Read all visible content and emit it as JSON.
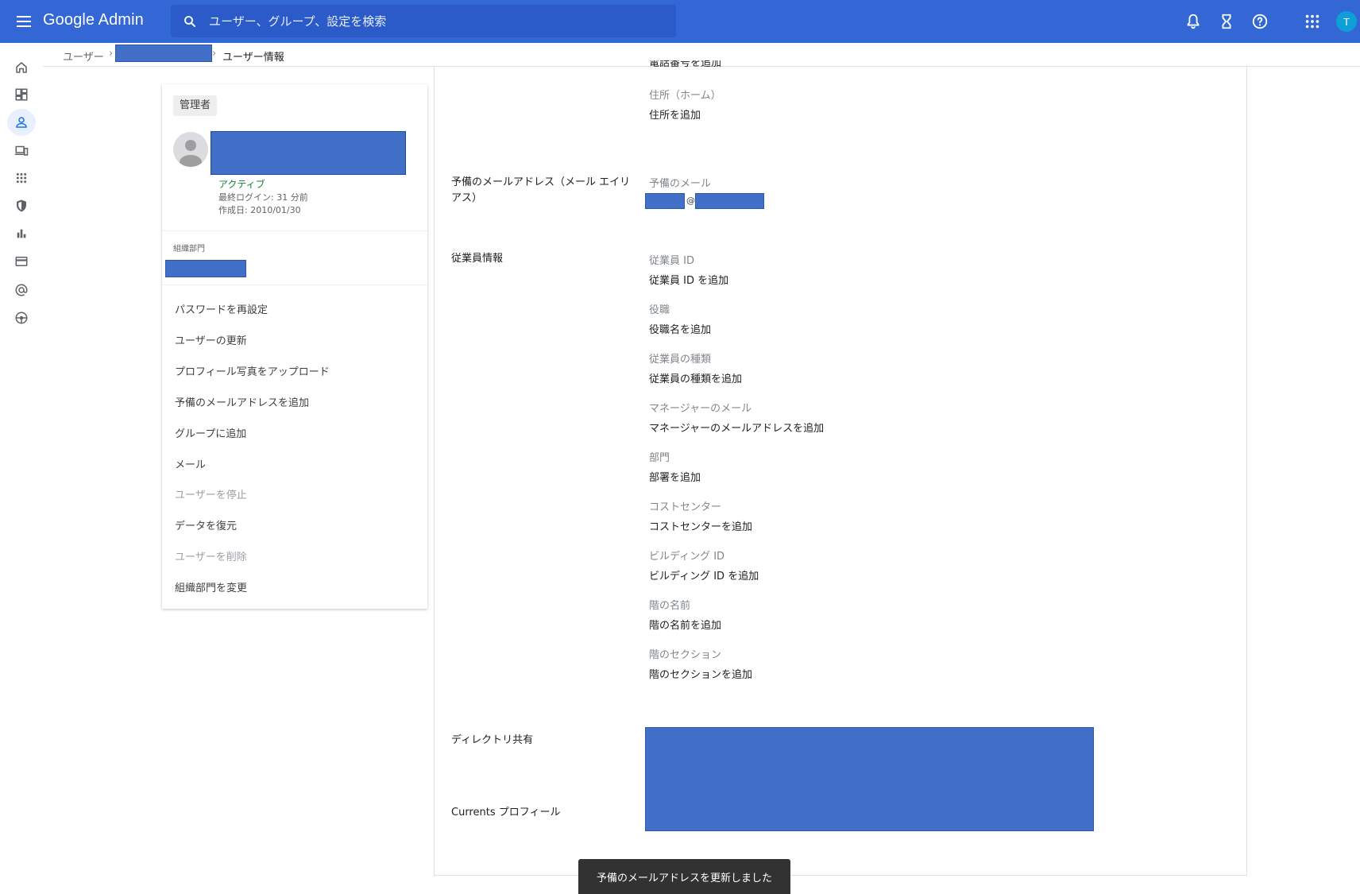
{
  "header": {
    "logo_text": "Google Admin",
    "search_placeholder": "ユーザー、グループ、設定を検索",
    "avatar_initial": "T"
  },
  "breadcrumb": {
    "users": "ユーザー",
    "separator": "›",
    "current": "ユーザー情報"
  },
  "user_card": {
    "role": "管理者",
    "status": "アクティブ",
    "last_login": "最終ログイン: 31 分前",
    "created": "作成日: 2010/01/30",
    "org_unit_label": "組織部門",
    "actions": [
      {
        "label": "パスワードを再設定",
        "enabled": true
      },
      {
        "label": "ユーザーの更新",
        "enabled": true
      },
      {
        "label": "プロフィール写真をアップロード",
        "enabled": true
      },
      {
        "label": "予備のメールアドレスを追加",
        "enabled": true
      },
      {
        "label": "グループに追加",
        "enabled": true
      },
      {
        "label": "メール",
        "enabled": true
      },
      {
        "label": "ユーザーを停止",
        "enabled": false
      },
      {
        "label": "データを復元",
        "enabled": true
      },
      {
        "label": "ユーザーを削除",
        "enabled": false
      },
      {
        "label": "組織部門を変更",
        "enabled": true
      }
    ]
  },
  "details": {
    "clipped_top_text": "電話番号を追加",
    "address_home_label": "住所（ホーム）",
    "address_home_value": "住所を追加",
    "alt_email_section": "予備のメールアドレス（メール エイリアス）",
    "alt_email_label": "予備のメール",
    "at_sign": "@",
    "employee_section": "従業員情報",
    "employee_fields": [
      {
        "label": "従業員 ID",
        "value": "従業員 ID を追加"
      },
      {
        "label": "役職",
        "value": "役職名を追加"
      },
      {
        "label": "従業員の種類",
        "value": "従業員の種類を追加"
      },
      {
        "label": "マネージャーのメール",
        "value": "マネージャーのメールアドレスを追加"
      },
      {
        "label": "部門",
        "value": "部署を追加"
      },
      {
        "label": "コストセンター",
        "value": "コストセンターを追加"
      },
      {
        "label": "ビルディング ID",
        "value": "ビルディング ID を追加"
      },
      {
        "label": "階の名前",
        "value": "階の名前を追加"
      },
      {
        "label": "階のセクション",
        "value": "階のセクションを追加"
      }
    ],
    "directory_sharing": "ディレクトリ共有",
    "currents_profile": "Currents プロフィール"
  },
  "snackbar": {
    "message": "予備のメールアドレスを更新しました"
  },
  "colors": {
    "topbar": "#3367d6",
    "redaction": "#4270c8",
    "active_status": "#188038",
    "snackbar": "#323232"
  },
  "icons": {
    "header": [
      "menu-icon",
      "search-icon",
      "bell-icon",
      "hourglass-icon",
      "help-icon",
      "apps-icon"
    ],
    "rail": [
      "home-icon",
      "dashboard-icon",
      "user-icon",
      "devices-icon",
      "apps-icon",
      "security-icon",
      "reports-icon",
      "billing-icon",
      "domain-icon",
      "support-icon"
    ]
  }
}
